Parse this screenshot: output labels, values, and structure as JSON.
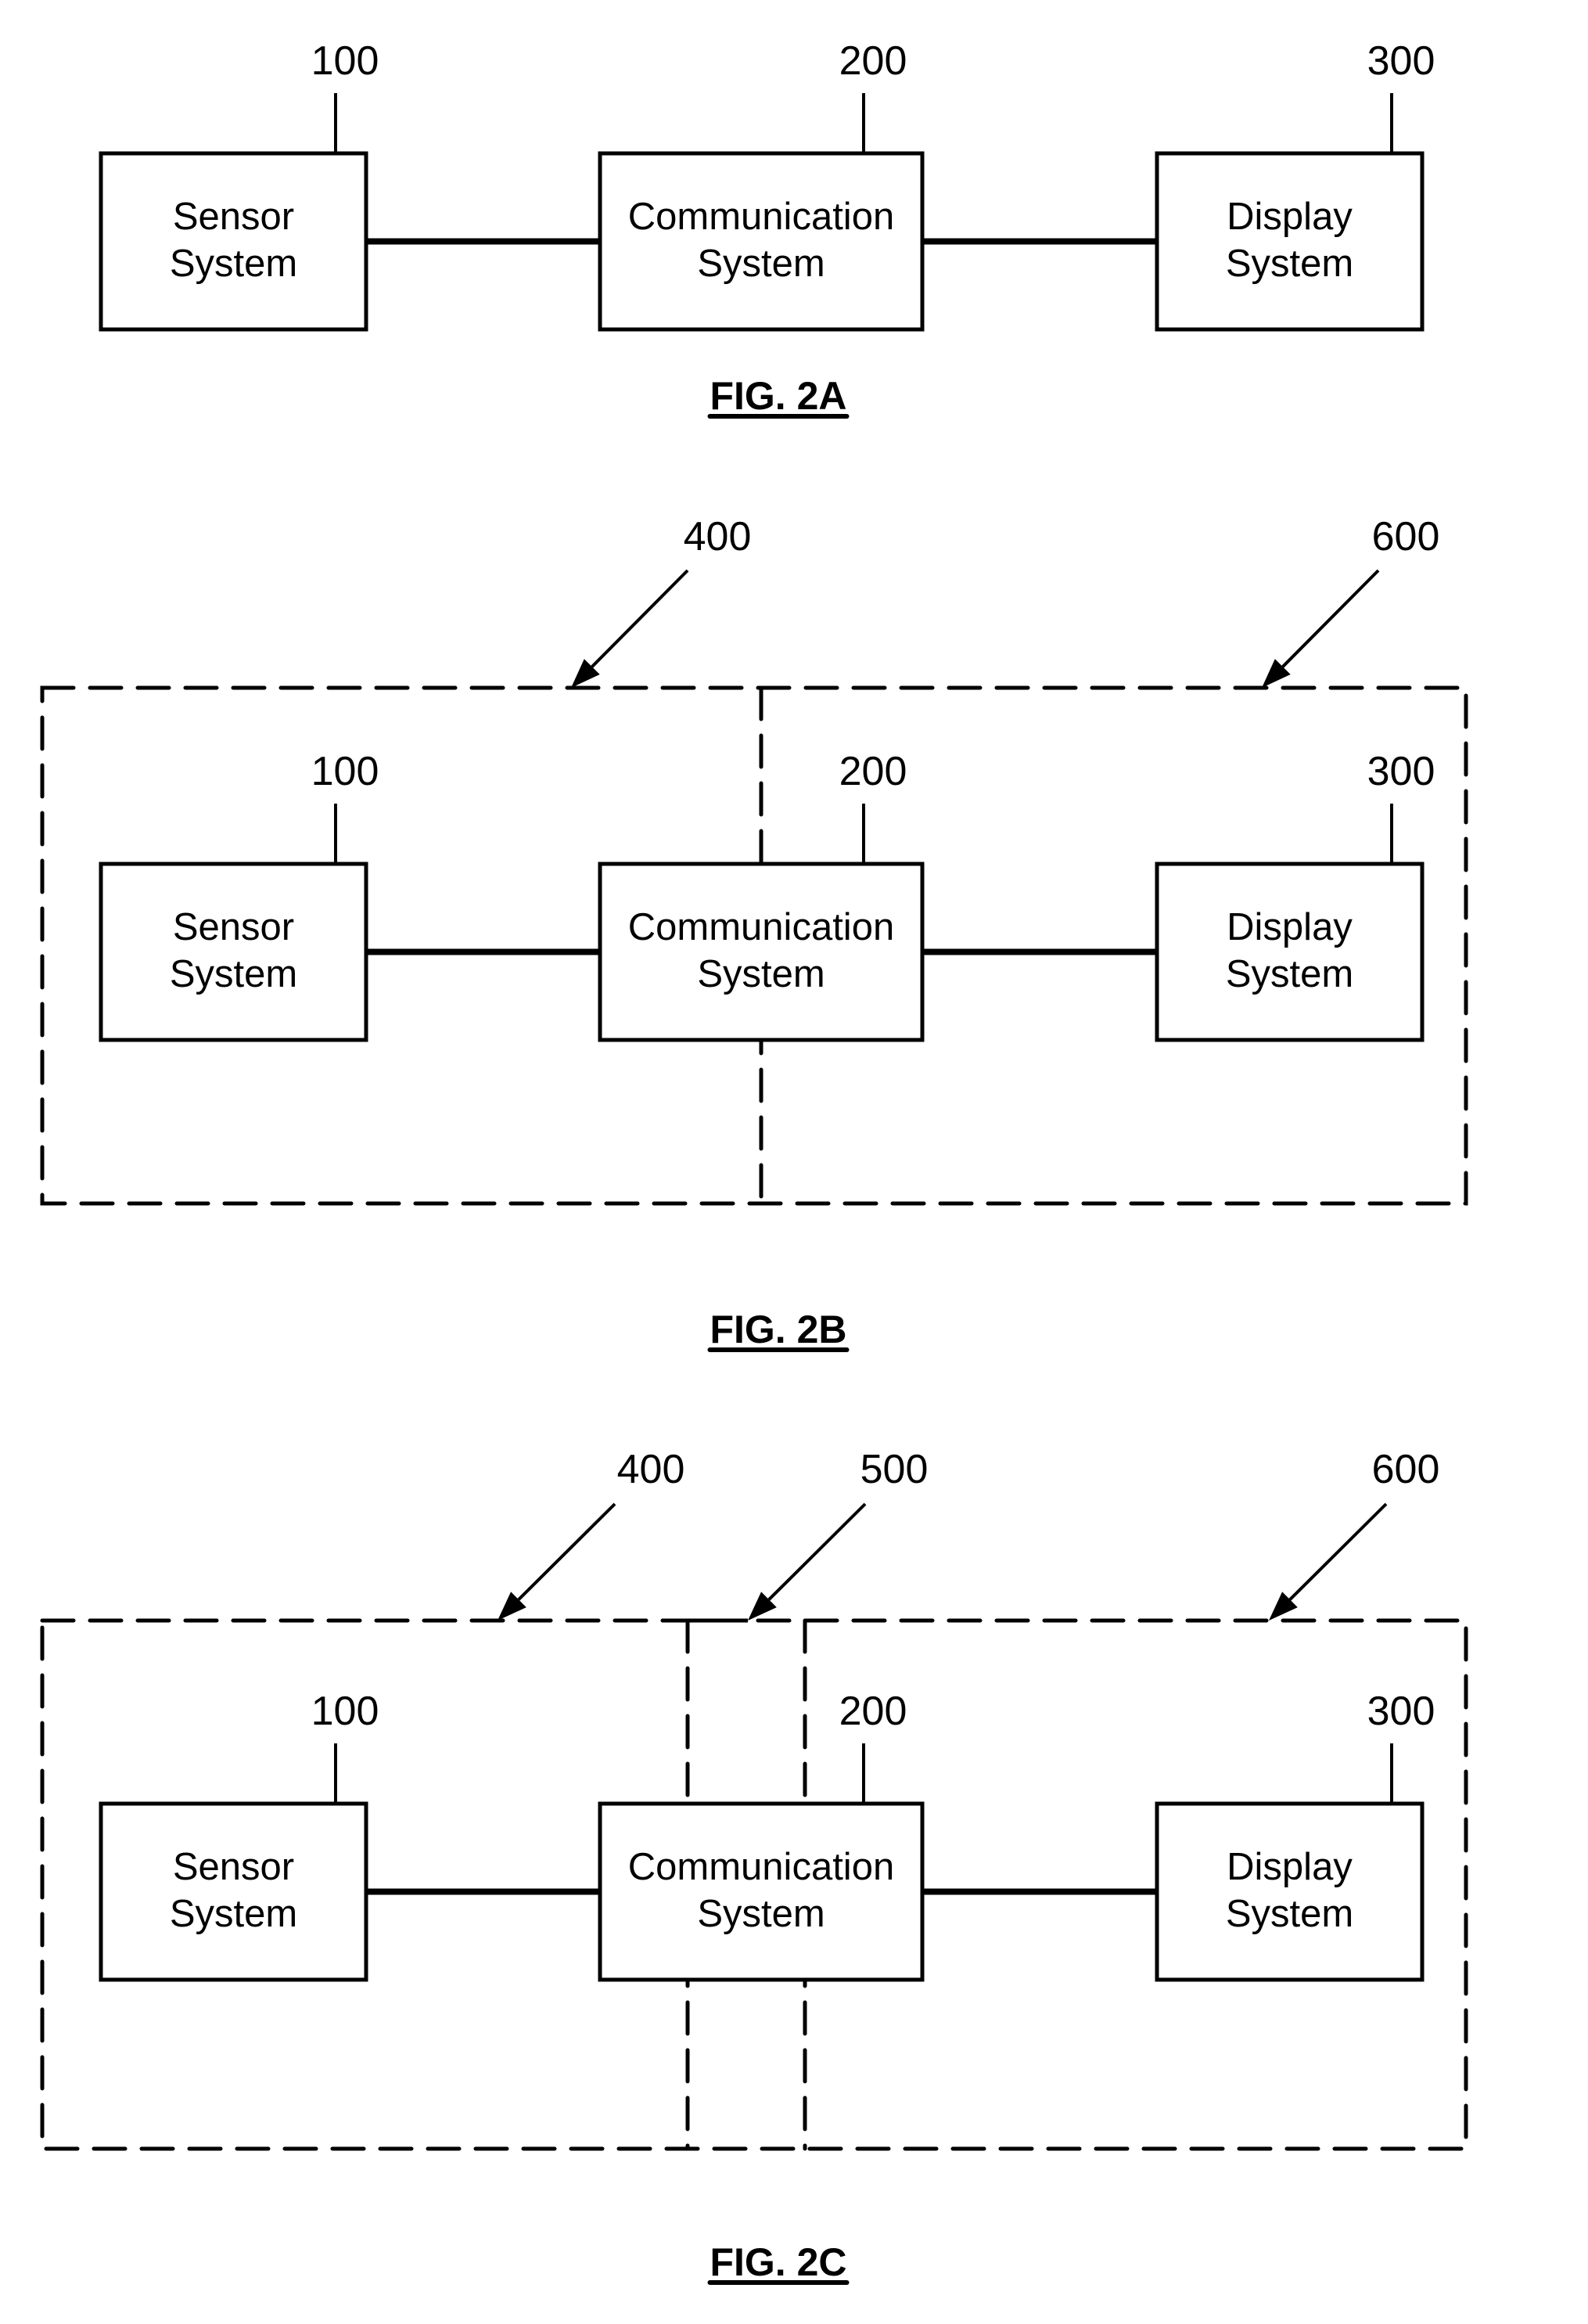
{
  "figures": [
    {
      "id": "2A",
      "title": "FIG. 2A",
      "blocks": [
        {
          "ref": "100",
          "lines": [
            "Sensor",
            "System"
          ]
        },
        {
          "ref": "200",
          "lines": [
            "Communication",
            "System"
          ]
        },
        {
          "ref": "300",
          "lines": [
            "Display",
            "System"
          ]
        }
      ],
      "connections": [
        [
          "100",
          "200"
        ],
        [
          "200",
          "300"
        ]
      ],
      "groups": []
    },
    {
      "id": "2B",
      "title": "FIG. 2B",
      "blocks": [
        {
          "ref": "100",
          "lines": [
            "Sensor",
            "System"
          ]
        },
        {
          "ref": "200",
          "lines": [
            "Communication",
            "System"
          ]
        },
        {
          "ref": "300",
          "lines": [
            "Display",
            "System"
          ]
        }
      ],
      "connections": [
        [
          "100",
          "200"
        ],
        [
          "200",
          "300"
        ]
      ],
      "groups": [
        {
          "ref": "400",
          "contains": [
            "100",
            "200"
          ],
          "style": "dashed"
        },
        {
          "ref": "600",
          "contains": [
            "200",
            "300"
          ],
          "style": "dashed"
        }
      ]
    },
    {
      "id": "2C",
      "title": "FIG. 2C",
      "blocks": [
        {
          "ref": "100",
          "lines": [
            "Sensor",
            "System"
          ]
        },
        {
          "ref": "200",
          "lines": [
            "Communication",
            "System"
          ]
        },
        {
          "ref": "300",
          "lines": [
            "Display",
            "System"
          ]
        }
      ],
      "connections": [
        [
          "100",
          "200"
        ],
        [
          "200",
          "300"
        ]
      ],
      "groups": [
        {
          "ref": "400",
          "contains": [
            "100",
            "200"
          ],
          "style": "dashed"
        },
        {
          "ref": "500",
          "contains": [
            "200"
          ],
          "style": "dashed"
        },
        {
          "ref": "600",
          "contains": [
            "200",
            "300"
          ],
          "style": "dashed"
        }
      ]
    }
  ]
}
